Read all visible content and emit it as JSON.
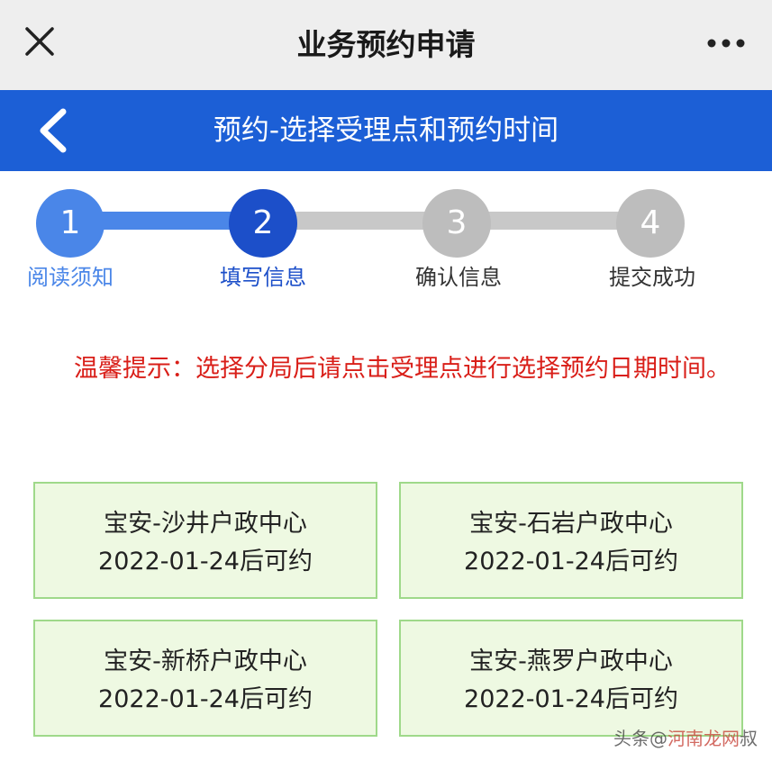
{
  "topbar": {
    "title": "业务预约申请",
    "close_icon": "close-icon",
    "more_icon": "more-icon"
  },
  "subheader": {
    "title": "预约-选择受理点和预约时间",
    "back_icon": "chevron-left-icon",
    "color": "#1c5fd6"
  },
  "steps": [
    {
      "number": "1",
      "label": "阅读须知",
      "state": "done"
    },
    {
      "number": "2",
      "label": "填写信息",
      "state": "current"
    },
    {
      "number": "3",
      "label": "确认信息",
      "state": "pending"
    },
    {
      "number": "4",
      "label": "提交成功",
      "state": "pending"
    }
  ],
  "notice": {
    "text": "温馨提示：选择分局后请点击受理点进行选择预约日期时间。",
    "color": "#d91e18"
  },
  "centers": [
    {
      "name": "宝安-沙井户政中心",
      "availability": "2022-01-24后可约"
    },
    {
      "name": "宝安-石岩户政中心",
      "availability": "2022-01-24后可约"
    },
    {
      "name": "宝安-新桥户政中心",
      "availability": "2022-01-24后可约"
    },
    {
      "name": "宝安-燕罗户政中心",
      "availability": "2022-01-24后可约"
    }
  ],
  "watermark": {
    "prefix": "头条@",
    "accent": "河南龙网",
    "suffix": "叔"
  }
}
